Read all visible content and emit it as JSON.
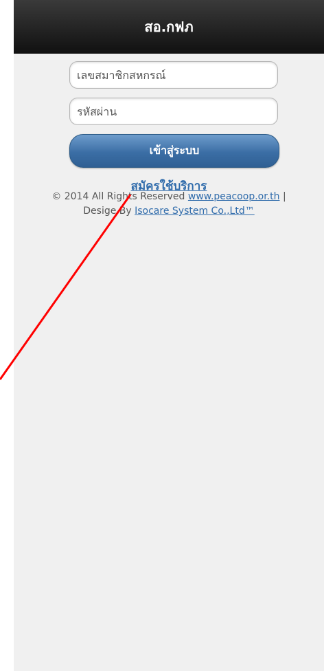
{
  "header": {
    "title": "สอ.กฟภ"
  },
  "login_form": {
    "member_id_placeholder": "เลขสมาชิกสหกรณ์",
    "password_placeholder": "รหัสผ่าน",
    "login_button_label": "เข้าสู่ระบบ",
    "register_link_label": "สมัครใช้บริการ"
  },
  "footer": {
    "copyright_text": "© 2014 All Rights Reserved",
    "site_link": "www.peacoop.or.th",
    "separator": "|",
    "design_by_text": "Desige By",
    "designer_link": "Isocare System Co.,Ltd™"
  },
  "colors": {
    "header_bg": "#1a1a1a",
    "button_bg": "#3b6ea5",
    "link": "#2f6bab",
    "annotation_line": "#ff0000"
  }
}
